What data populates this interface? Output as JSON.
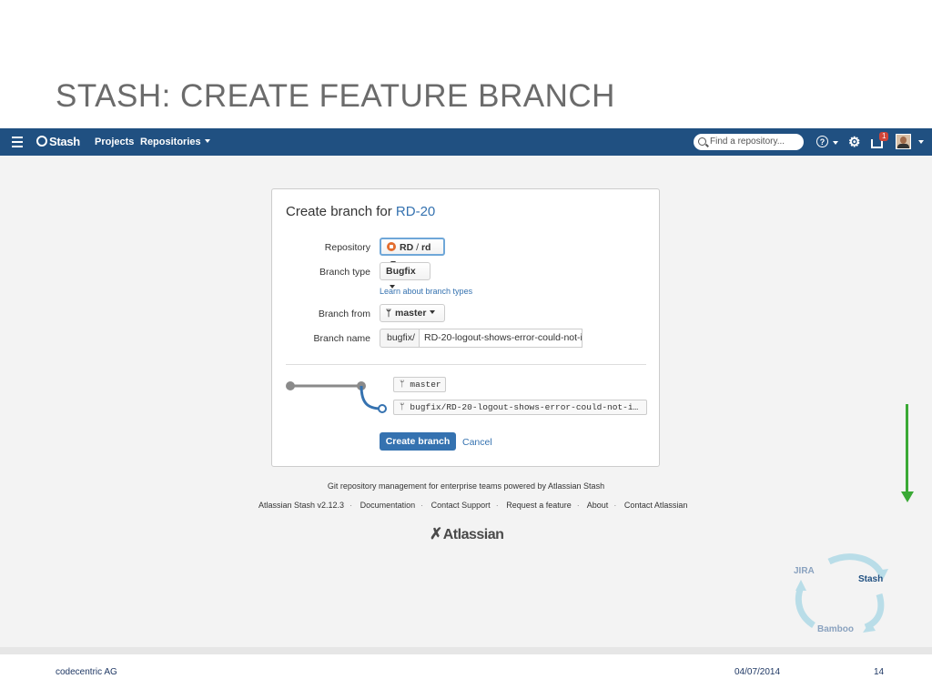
{
  "slide": {
    "title": "STASH: CREATE FEATURE BRANCH",
    "footer_company": "codecentric AG",
    "footer_date": "04/07/2014",
    "page_number": "14"
  },
  "topbar": {
    "brand": "Stash",
    "nav": [
      "Projects",
      "Repositories"
    ],
    "search_placeholder": "Find a repository...",
    "help_glyph": "?",
    "gear_glyph": "⚙",
    "notifications_count": "1",
    "colors": {
      "bar": "#205081"
    }
  },
  "dialog": {
    "title_prefix": "Create branch for",
    "title_issue": "RD-20",
    "repository_label": "Repository",
    "repository_project": "RD",
    "repository_sep": " / ",
    "repository_name": "rd",
    "branch_type_label": "Branch type",
    "branch_type_value": "Bugfix",
    "learn_link": "Learn about branch types",
    "branch_from_label": "Branch from",
    "branch_from_value": "master",
    "branch_name_label": "Branch name",
    "branch_prefix": "bugfix/",
    "branch_name_value": "RD-20-logout-shows-error-could-not-i",
    "diagram_source": "master",
    "diagram_target": "bugfix/RD-20-logout-shows-error-could-not-i…",
    "create_button": "Create branch",
    "cancel_link": "Cancel",
    "colors": {
      "primary": "#3572b0"
    }
  },
  "page_footer": {
    "tagline": "Git repository management for enterprise teams powered by Atlassian Stash",
    "links": [
      "Atlassian Stash v2.12.3",
      "Documentation",
      "Contact Support",
      "Request a feature",
      "About",
      "Contact Atlassian"
    ],
    "separator": "·",
    "atlassian_logo": "Atlassian"
  },
  "cycle_graphic": {
    "jira": "JIRA",
    "stash": "Stash",
    "bamboo": "Bamboo"
  },
  "accent": {
    "arrow": "#3aa935"
  }
}
